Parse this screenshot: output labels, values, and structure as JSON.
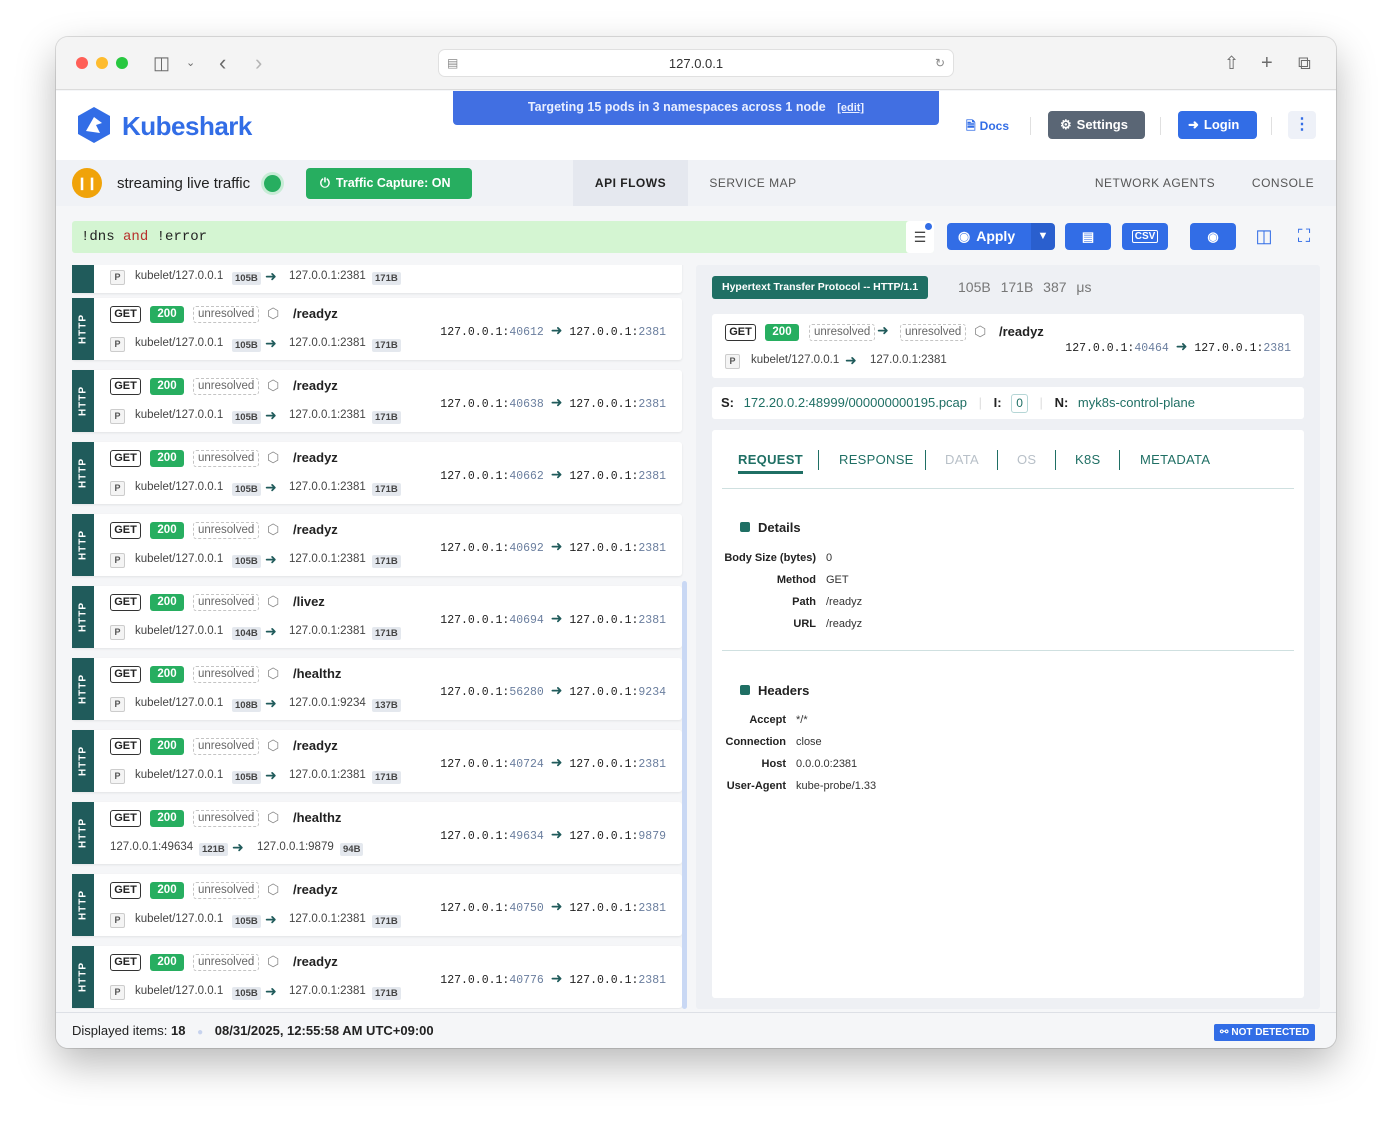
{
  "browser": {
    "url": "127.0.0.1"
  },
  "header": {
    "brand": "Kubeshark",
    "banner_text": "Targeting 15 pods in 3 namespaces across 1 node",
    "banner_edit": "[edit]",
    "docs_label": "Docs",
    "settings_label": "Settings",
    "login_label": "Login"
  },
  "toolbar": {
    "stream_label": "streaming live traffic",
    "capture_label": "Traffic Capture: ON",
    "tabs": [
      "API FLOWS",
      "SERVICE MAP",
      "NETWORK AGENTS",
      "CONSOLE"
    ]
  },
  "filter": {
    "part1": "!dns ",
    "keyword": "and",
    "part2": " !error",
    "apply_label": "Apply",
    "csv_label": "CSV"
  },
  "entries": [
    {
      "protocol": "HTTP",
      "method": "GET",
      "status": "200",
      "resolution": "unresolved",
      "path": "/readyz",
      "src_name": "kubelet/127.0.0.1",
      "req_size": "105B",
      "dst_name": "127.0.0.1:2381",
      "res_size": "171B",
      "src_ip": "127.0.0.1:",
      "src_port": "40612",
      "dst_ip": "127.0.0.1:",
      "dst_port": "2381"
    },
    {
      "protocol": "HTTP",
      "method": "GET",
      "status": "200",
      "resolution": "unresolved",
      "path": "/readyz",
      "src_name": "kubelet/127.0.0.1",
      "req_size": "105B",
      "dst_name": "127.0.0.1:2381",
      "res_size": "171B",
      "src_ip": "127.0.0.1:",
      "src_port": "40638",
      "dst_ip": "127.0.0.1:",
      "dst_port": "2381"
    },
    {
      "protocol": "HTTP",
      "method": "GET",
      "status": "200",
      "resolution": "unresolved",
      "path": "/readyz",
      "src_name": "kubelet/127.0.0.1",
      "req_size": "105B",
      "dst_name": "127.0.0.1:2381",
      "res_size": "171B",
      "src_ip": "127.0.0.1:",
      "src_port": "40662",
      "dst_ip": "127.0.0.1:",
      "dst_port": "2381"
    },
    {
      "protocol": "HTTP",
      "method": "GET",
      "status": "200",
      "resolution": "unresolved",
      "path": "/readyz",
      "src_name": "kubelet/127.0.0.1",
      "req_size": "105B",
      "dst_name": "127.0.0.1:2381",
      "res_size": "171B",
      "src_ip": "127.0.0.1:",
      "src_port": "40692",
      "dst_ip": "127.0.0.1:",
      "dst_port": "2381"
    },
    {
      "protocol": "HTTP",
      "method": "GET",
      "status": "200",
      "resolution": "unresolved",
      "path": "/livez",
      "src_name": "kubelet/127.0.0.1",
      "req_size": "104B",
      "dst_name": "127.0.0.1:2381",
      "res_size": "171B",
      "src_ip": "127.0.0.1:",
      "src_port": "40694",
      "dst_ip": "127.0.0.1:",
      "dst_port": "2381"
    },
    {
      "protocol": "HTTP",
      "method": "GET",
      "status": "200",
      "resolution": "unresolved",
      "path": "/healthz",
      "src_name": "kubelet/127.0.0.1",
      "req_size": "108B",
      "dst_name": "127.0.0.1:9234",
      "res_size": "137B",
      "src_ip": "127.0.0.1:",
      "src_port": "56280",
      "dst_ip": "127.0.0.1:",
      "dst_port": "9234"
    },
    {
      "protocol": "HTTP",
      "method": "GET",
      "status": "200",
      "resolution": "unresolved",
      "path": "/readyz",
      "src_name": "kubelet/127.0.0.1",
      "req_size": "105B",
      "dst_name": "127.0.0.1:2381",
      "res_size": "171B",
      "src_ip": "127.0.0.1:",
      "src_port": "40724",
      "dst_ip": "127.0.0.1:",
      "dst_port": "2381"
    },
    {
      "protocol": "HTTP",
      "method": "GET",
      "status": "200",
      "resolution": "unresolved",
      "path": "/healthz",
      "src_name": "127.0.0.1:49634",
      "req_size": "121B",
      "dst_name": "127.0.0.1:9879",
      "res_size": "94B",
      "src_ip": "127.0.0.1:",
      "src_port": "49634",
      "dst_ip": "127.0.0.1:",
      "dst_port": "9879",
      "no_p": true
    },
    {
      "protocol": "HTTP",
      "method": "GET",
      "status": "200",
      "resolution": "unresolved",
      "path": "/readyz",
      "src_name": "kubelet/127.0.0.1",
      "req_size": "105B",
      "dst_name": "127.0.0.1:2381",
      "res_size": "171B",
      "src_ip": "127.0.0.1:",
      "src_port": "40750",
      "dst_ip": "127.0.0.1:",
      "dst_port": "2381"
    },
    {
      "protocol": "HTTP",
      "method": "GET",
      "status": "200",
      "resolution": "unresolved",
      "path": "/readyz",
      "src_name": "kubelet/127.0.0.1",
      "req_size": "105B",
      "dst_name": "127.0.0.1:2381",
      "res_size": "171B",
      "src_ip": "127.0.0.1:",
      "src_port": "40776",
      "dst_ip": "127.0.0.1:",
      "dst_port": "2381"
    }
  ],
  "partial_entry": {
    "src_name": "kubelet/127.0.0.1",
    "req_size": "105B",
    "dst_name": "127.0.0.1:2381",
    "res_size": "171B"
  },
  "detail": {
    "protocol_badge": "Hypertext Transfer Protocol -- HTTP/1.1",
    "stats": "105B 171B 387 μs",
    "method": "GET",
    "status": "200",
    "src_resolution": "unresolved",
    "dst_resolution": "unresolved",
    "path": "/readyz",
    "src_name": "kubelet/127.0.0.1",
    "dst_name": "127.0.0.1:2381",
    "src_ip": "127.0.0.1:",
    "src_port": "40464",
    "dst_ip": "127.0.0.1:",
    "dst_port": "2381",
    "s_label": "S:",
    "s_value": "172.20.0.2:48999/000000000195.pcap",
    "i_label": "I:",
    "i_value": "0",
    "n_label": "N:",
    "n_value": "myk8s-control-plane",
    "tabs": [
      "REQUEST",
      "RESPONSE",
      "DATA",
      "OS",
      "K8S",
      "METADATA"
    ],
    "details_title": "Details",
    "details": [
      {
        "k": "Body Size (bytes)",
        "v": "0"
      },
      {
        "k": "Method",
        "v": "GET"
      },
      {
        "k": "Path",
        "v": "/readyz"
      },
      {
        "k": "URL",
        "v": "/readyz"
      }
    ],
    "headers_title": "Headers",
    "headers": [
      {
        "k": "Accept",
        "v": "*/*"
      },
      {
        "k": "Connection",
        "v": "close"
      },
      {
        "k": "Host",
        "v": "0.0.0.0:2381"
      },
      {
        "k": "User-Agent",
        "v": "kube-probe/1.33"
      }
    ]
  },
  "footer": {
    "displayed_label": "Displayed items:",
    "displayed_count": "18",
    "timestamp": "08/31/2025, 12:55:58 AM UTC+09:00",
    "not_detected": "NOT DETECTED"
  },
  "colors": {
    "accent": "#326de6",
    "protocol_side": "#205b5b",
    "status_ok": "#27ae60",
    "filter_bg": "#d4f5d2"
  }
}
